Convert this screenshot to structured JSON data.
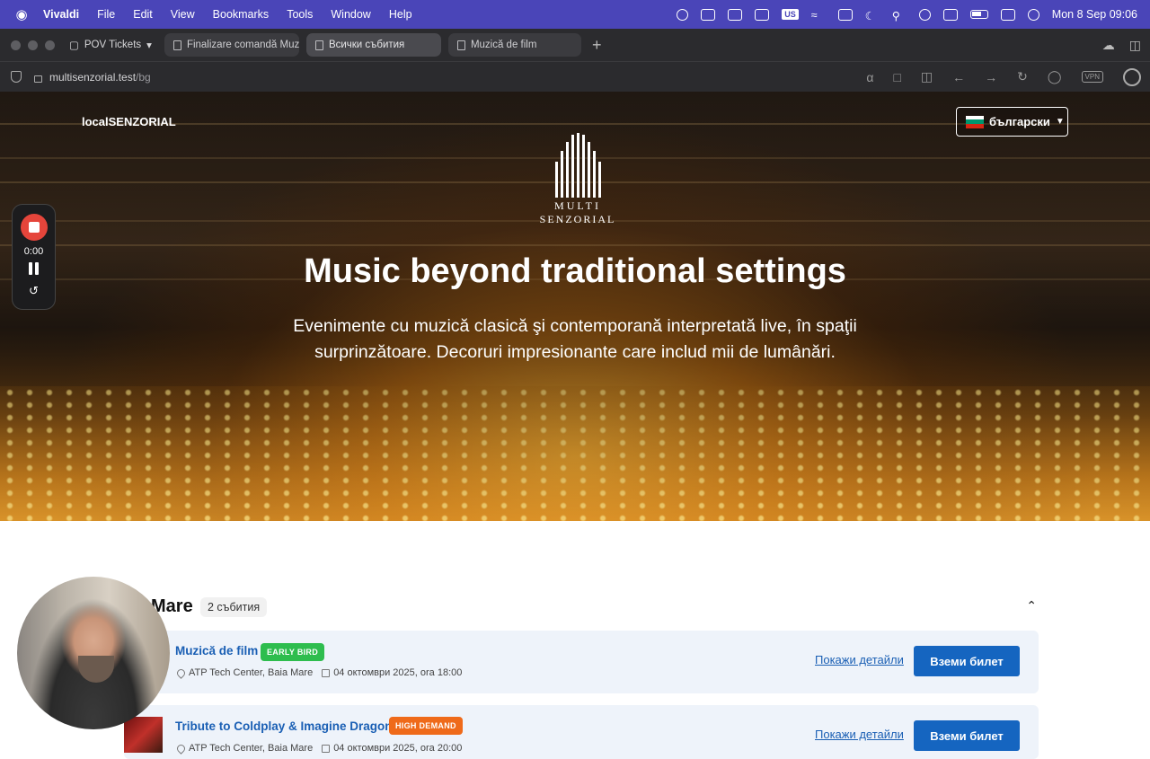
{
  "menubar": {
    "app_name": "Vivaldi",
    "items": [
      "File",
      "Edit",
      "View",
      "Bookmarks",
      "Tools",
      "Window",
      "Help"
    ],
    "keyboard_layout": "US",
    "datetime": "Mon 8 Sep  09:06"
  },
  "browser": {
    "workspace": "POV Tickets",
    "tabs": [
      {
        "label": "Finalizare comandă Muzic",
        "active": false
      },
      {
        "label": "Всички събития",
        "active": true
      },
      {
        "label": "Muzică de film",
        "active": false
      }
    ],
    "url_host": "multisenzorial.test",
    "url_path": "/bg",
    "vpn_label": "VPN"
  },
  "site": {
    "brand": "localSENZORIAL",
    "language": "български",
    "logo_line1": "MULTI",
    "logo_line2": "SENZORIAL",
    "hero_title": "Music beyond traditional settings",
    "hero_subtitle": "Evenimente cu muzică clasică şi contemporană interpretată live, în spaţii surprinzătoare. Decoruri impresionante care includ mii de lumânări."
  },
  "recorder": {
    "time": "0:00"
  },
  "section": {
    "title": "Mare",
    "count": "2 събития"
  },
  "events": [
    {
      "title": "Muzică de film",
      "badge": "EARLY BIRD",
      "badge_color": "#2ebd4e",
      "location": "ATP Tech Center, Baia Mare",
      "date": "04 октомври 2025, ora 18:00",
      "details_label": "Покажи детайли",
      "buy_label": "Вземи билет"
    },
    {
      "title": "Tribute to Coldplay & Imagine Dragons",
      "badge": "HIGH DEMAND",
      "badge_color": "#ef6a1a",
      "location": "ATP Tech Center, Baia Mare",
      "date": "04 октомври 2025, ora 20:00",
      "details_label": "Покажи детайли",
      "buy_label": "Вземи билет"
    }
  ]
}
